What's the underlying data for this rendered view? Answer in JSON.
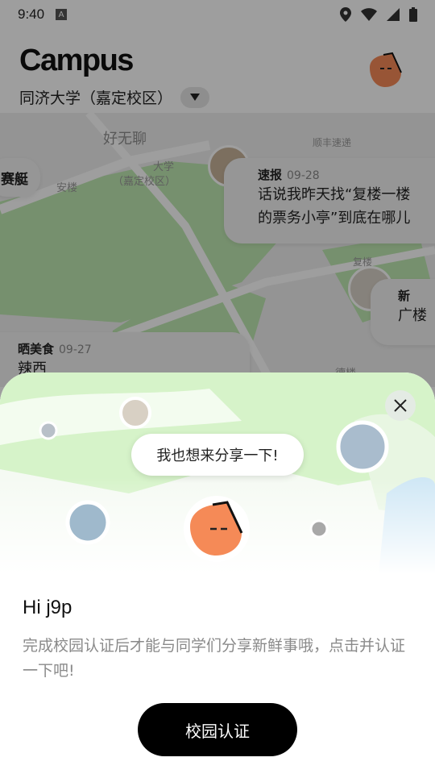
{
  "status_bar": {
    "time": "9:40",
    "notification_letter": "A",
    "icons": [
      "location-icon",
      "wifi-icon",
      "signal-icon",
      "battery-icon"
    ]
  },
  "header": {
    "app_title": "Campus",
    "campus_name": "同济大学（嘉定校区）",
    "dropdown_icon": "triangle-down-icon"
  },
  "map": {
    "labels": {
      "chat_board": "好无聊",
      "campus_short": "大学",
      "campus_district": "（嘉定校区）",
      "building_a": "安楼",
      "building_b": "嘉",
      "road_note": "顺丰速递",
      "place_c": "德楼",
      "place_d": "复楼"
    },
    "left_chip": "赛艇",
    "posts": [
      {
        "tag": "速报",
        "date": "09-28",
        "line1": "话说我昨天找“复楼一楼",
        "line2": "的票务小亭”到底在哪儿"
      },
      {
        "tag": "新",
        "line1": "广楼"
      },
      {
        "tag": "晒美食",
        "date": "09-27",
        "line1": "辣西"
      }
    ]
  },
  "sheet": {
    "close_icon": "close-icon",
    "share_prompt": "我也想来分享一下!",
    "greeting": "Hi j9p",
    "description": "完成校园认证后才能与同学们分享新鲜事哦，点击并认证一下吧!",
    "cta_label": "校园认证"
  },
  "colors": {
    "accent_orange": "#f58a57",
    "button_black": "#000000",
    "map_green": "#bfe8b2",
    "map_water": "#bfe2f3"
  }
}
